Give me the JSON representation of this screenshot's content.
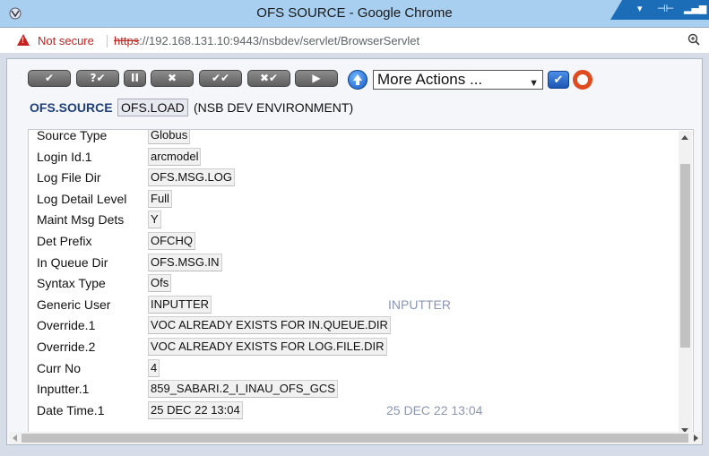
{
  "window": {
    "title": "OFS SOURCE - Google Chrome"
  },
  "address_bar": {
    "security_label": "Not secure",
    "url_scheme": "https",
    "url_rest": "://192.168.131.10:9443/nsbdev/servlet/BrowserServlet"
  },
  "toolbar": {
    "buttons": [
      "✔",
      "?✔",
      "II",
      "✖",
      "✔✔",
      "✖✔",
      "▶"
    ],
    "actions_select": "More Actions ...",
    "ok_label": "✔"
  },
  "header": {
    "application": "OFS.SOURCE",
    "record_id": "OFS.LOAD",
    "environment": "(NSB DEV ENVIRONMENT)"
  },
  "fields": [
    {
      "label": "Source Type",
      "value": "Globus"
    },
    {
      "label": "Login Id.1",
      "value": "arcmodel"
    },
    {
      "label": "Log File Dir",
      "value": "OFS.MSG.LOG"
    },
    {
      "label": "Log Detail Level",
      "value": "Full"
    },
    {
      "label": "Maint Msg Dets",
      "value": "Y"
    },
    {
      "label": "Det Prefix",
      "value": "OFCHQ"
    },
    {
      "label": "In Queue Dir",
      "value": "OFS.MSG.IN"
    },
    {
      "label": "Syntax Type",
      "value": "Ofs"
    },
    {
      "label": "Generic User",
      "value": "INPUTTER",
      "enrichment": "INPUTTER"
    },
    {
      "label": "Override.1",
      "value": "VOC ALREADY EXISTS FOR IN.QUEUE.DIR"
    },
    {
      "label": "Override.2",
      "value": "VOC ALREADY EXISTS FOR LOG.FILE.DIR"
    },
    {
      "label": "Curr No",
      "value": "4"
    },
    {
      "label": "Inputter.1",
      "value": "859_SABARI.2_I_INAU_OFS_GCS"
    },
    {
      "label": "Date Time.1",
      "value": "25 DEC 22 13:04",
      "enrichment": "25 DEC 22 13:04"
    }
  ]
}
